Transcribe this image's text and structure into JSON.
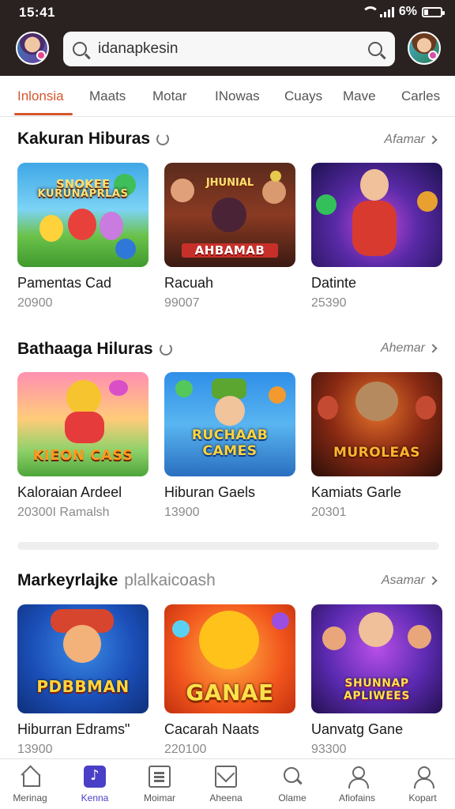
{
  "status": {
    "time": "15:41",
    "battery": "6%"
  },
  "search": {
    "value": "idanapkesin"
  },
  "tabs": [
    {
      "label": "Inlonsia",
      "active": true
    },
    {
      "label": "Maats"
    },
    {
      "label": "Motar"
    },
    {
      "label": "INowas"
    },
    {
      "label": "Cuays"
    },
    {
      "label": "Mave"
    },
    {
      "label": "Carles"
    }
  ],
  "sections": [
    {
      "title": "Kakuran Hiburas",
      "subtitle": "",
      "see_all": "Afamar",
      "cards": [
        {
          "art_top": "SNOKEE",
          "art_title": "KURUNAPRLAS",
          "name": "Pamentas Cad",
          "meta": "20900"
        },
        {
          "art_top": "JHUNIAL",
          "art_title": "AHBAMAB",
          "name": "Racuah",
          "meta": "99007"
        },
        {
          "art_top": "",
          "art_title": "",
          "name": "Datinte",
          "meta": "25390"
        }
      ]
    },
    {
      "title": "Bathaaga Hiluras",
      "subtitle": "",
      "see_all": "Ahemar",
      "cards": [
        {
          "art_top": "",
          "art_title": "KIEON CASS",
          "name": "Kaloraian Ardeel",
          "meta": "20300I  Ramalsh"
        },
        {
          "art_top": "",
          "art_title": "RUCHAAB CAMES",
          "name": "Hiburan Gaels",
          "meta": "13900"
        },
        {
          "art_top": "",
          "art_title": "MUROLEAS",
          "name": "Kamiats Garle",
          "meta": "20301"
        }
      ]
    },
    {
      "title": "Markeyrlajke",
      "subtitle": "plalkaicoash",
      "see_all": "Asamar",
      "cards": [
        {
          "art_top": "",
          "art_title": "PDBBMAN",
          "name": "Hiburran Edrams\"",
          "meta": "13900"
        },
        {
          "art_top": "",
          "art_title": "GANAE",
          "name": "Cacarah Naats",
          "meta": "220100"
        },
        {
          "art_top": "",
          "art_title": "SHUNNAP APLIWEES",
          "name": "Uanvatg Gane",
          "meta": "93300"
        }
      ]
    }
  ],
  "nav": [
    {
      "label": "Merinag",
      "icon": "home-icon"
    },
    {
      "label": "Kenna",
      "icon": "games-icon",
      "active": true
    },
    {
      "label": "Moimar",
      "icon": "list-icon"
    },
    {
      "label": "Aheena",
      "icon": "mail-icon"
    },
    {
      "label": "Olame",
      "icon": "search-icon"
    },
    {
      "label": "Afiofains",
      "icon": "user-icon"
    },
    {
      "label": "Kopart",
      "icon": "profile-icon"
    }
  ],
  "colors": {
    "accent": "#d6562c",
    "nav_active": "#4a3fc7",
    "header_bg": "#2a2221"
  }
}
